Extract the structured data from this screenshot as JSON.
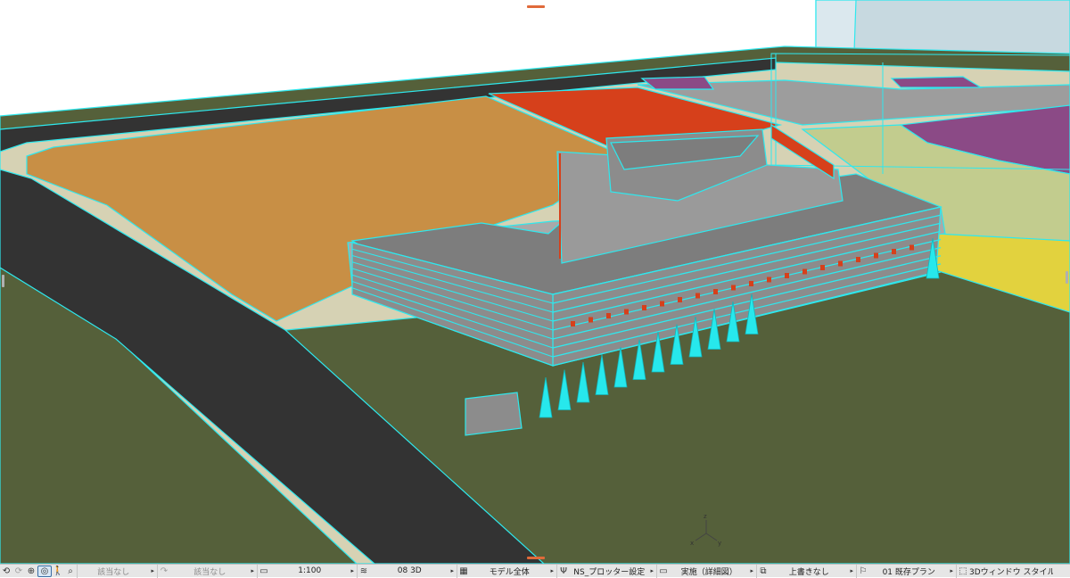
{
  "viewport": {
    "view_type": "3D model view",
    "colors": {
      "contour": "#2ee8ee",
      "road": "#333333",
      "grass": "#55603a",
      "paving": "#d6d2b4",
      "lot_orange": "#c88f45",
      "lot_red": "#d6401b",
      "lot_purple": "#8b4a86",
      "lot_yellow": "#e2d23e",
      "lot_green": "#c2cc8e",
      "building": "#8c8c8c",
      "tree": "#27e8ec"
    },
    "axis_labels": {
      "x": "x",
      "y": "y",
      "z": "z"
    }
  },
  "statusbar": {
    "nav_icons": [
      "undo-view-icon",
      "redo-view-icon",
      "zoom-icon",
      "orbit-icon",
      "walk-icon",
      "find-icon"
    ],
    "field1": {
      "label": "該当なし"
    },
    "field2": {
      "label": "該当なし"
    },
    "scale": {
      "value": "1:100"
    },
    "layer_combination": {
      "value": "08 3D"
    },
    "model_view": {
      "value": "モデル全体"
    },
    "pen_set": {
      "value": "NS_プロッター設定"
    },
    "dimension_style": {
      "value": "実施（詳細図）"
    },
    "override": {
      "value": "上書きなし"
    },
    "renovation_filter": {
      "value": "01 既存プラン"
    },
    "window_style": {
      "value": "3Dウィンドウ スタイル"
    }
  }
}
